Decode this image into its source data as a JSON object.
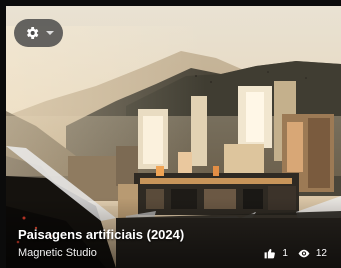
{
  "card": {
    "title": "Paisagens artificiais (2024)",
    "author": "Magnetic Studio",
    "likes": "1",
    "views": "12"
  },
  "controls": {
    "settings_icon": "gear-icon",
    "dropdown_icon": "caret-down-icon"
  },
  "icons": {
    "likes": "thumbs-up-icon",
    "views": "eye-icon"
  },
  "colors": {
    "sky": "#e7dcc8",
    "haze": "#c9b89a",
    "mountain": "#4a4537",
    "accent": "#e8873a"
  }
}
